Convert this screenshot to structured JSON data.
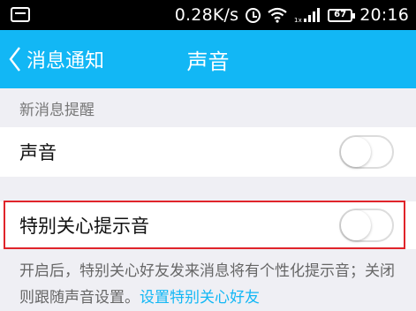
{
  "status_bar": {
    "network_speed": "0.28K/s",
    "signal_label": "1x",
    "battery_level": "67",
    "time": "20:16"
  },
  "header": {
    "back_label": "消息通知",
    "title": "声音",
    "bg_color": "#12b7f5"
  },
  "section": {
    "header": "新消息提醒"
  },
  "settings": [
    {
      "label": "声音",
      "toggle_on": false
    },
    {
      "label": "特别关心提示音",
      "toggle_on": false
    }
  ],
  "footer": {
    "line1": "开启后，特别关心好友发来消息将有个性化提示音；关闭",
    "line2_text": "则跟随声音设置。",
    "line2_link": "设置特别关心好友"
  },
  "colors": {
    "accent": "#12b7f5",
    "highlight": "#e0242a"
  }
}
